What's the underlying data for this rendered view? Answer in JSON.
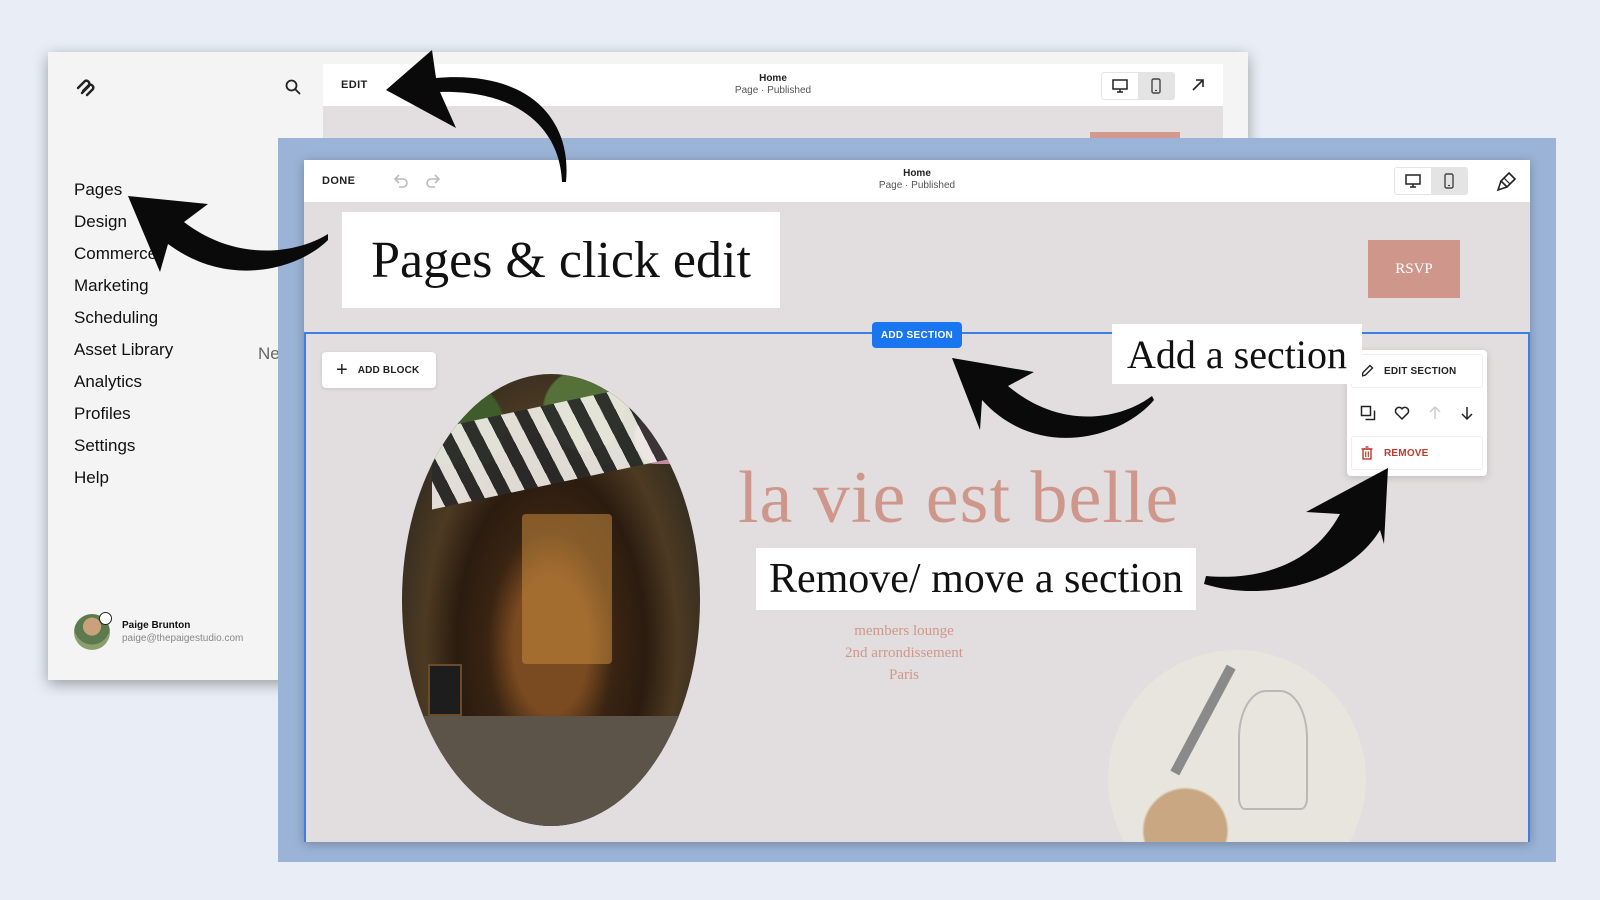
{
  "back_window": {
    "nav_items": [
      "Pages",
      "Design",
      "Commerce",
      "Marketing",
      "Scheduling",
      "Asset Library",
      "Analytics",
      "Profiles",
      "Settings",
      "Help"
    ],
    "nav_new_badge": "Ne",
    "user": {
      "name": "Paige Brunton",
      "email": "paige@thepaigestudio.com"
    },
    "toolbar": {
      "edit_label": "EDIT",
      "page_title": "Home",
      "page_status": "Page · Published"
    }
  },
  "front_window": {
    "toolbar": {
      "done_label": "DONE",
      "page_title": "Home",
      "page_status": "Page · Published"
    },
    "rsvp_label": "RSVP",
    "add_section_label": "ADD SECTION",
    "add_block_label": "ADD BLOCK",
    "hero_title": "la vie est belle",
    "tagline": [
      "members lounge",
      "2nd arrondissement",
      "Paris"
    ],
    "section_menu": {
      "edit_label": "EDIT SECTION",
      "remove_label": "REMOVE"
    }
  },
  "callouts": {
    "pages_edit": "Pages & click edit",
    "add_section": "Add a section",
    "remove_move": "Remove/ move a section"
  },
  "colors": {
    "accent_blue": "#1976f0",
    "rose": "#cf978b",
    "frame_blue": "#9bb3d6"
  }
}
